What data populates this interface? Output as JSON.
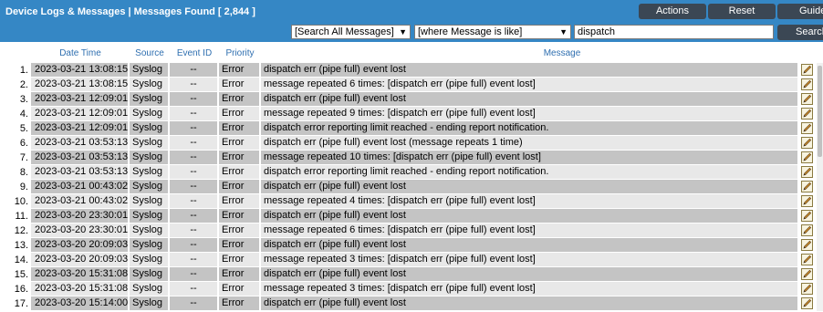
{
  "header": {
    "title": "Device Logs & Messages |  Messages Found [ 2,844 ]",
    "actions_label": "Actions",
    "reset_label": "Reset",
    "guide_label": "Guide"
  },
  "filter": {
    "scope_value": "[Search All Messages]",
    "condition_value": "[where Message is like]",
    "search_value": "dispatch",
    "search_label": "Search"
  },
  "columns": [
    "Date Time",
    "Source",
    "Event ID",
    "Priority",
    "Message"
  ],
  "rows": [
    {
      "num": "1.",
      "datetime": "2023-03-21 13:08:15",
      "source": "Syslog",
      "event_id": "--",
      "priority": "Error",
      "message": "dispatch err (pipe full) event lost"
    },
    {
      "num": "2.",
      "datetime": "2023-03-21 13:08:15",
      "source": "Syslog",
      "event_id": "--",
      "priority": "Error",
      "message": "message repeated 6 times: [dispatch err (pipe full) event lost]"
    },
    {
      "num": "3.",
      "datetime": "2023-03-21 12:09:01",
      "source": "Syslog",
      "event_id": "--",
      "priority": "Error",
      "message": "dispatch err (pipe full) event lost"
    },
    {
      "num": "4.",
      "datetime": "2023-03-21 12:09:01",
      "source": "Syslog",
      "event_id": "--",
      "priority": "Error",
      "message": "message repeated 9 times: [dispatch err (pipe full) event lost]"
    },
    {
      "num": "5.",
      "datetime": "2023-03-21 12:09:01",
      "source": "Syslog",
      "event_id": "--",
      "priority": "Error",
      "message": "dispatch error reporting limit reached - ending report notification."
    },
    {
      "num": "6.",
      "datetime": "2023-03-21 03:53:13",
      "source": "Syslog",
      "event_id": "--",
      "priority": "Error",
      "message": "dispatch err (pipe full) event lost (message repeats 1 time)"
    },
    {
      "num": "7.",
      "datetime": "2023-03-21 03:53:13",
      "source": "Syslog",
      "event_id": "--",
      "priority": "Error",
      "message": "message repeated 10 times: [dispatch err (pipe full) event lost]"
    },
    {
      "num": "8.",
      "datetime": "2023-03-21 03:53:13",
      "source": "Syslog",
      "event_id": "--",
      "priority": "Error",
      "message": "dispatch error reporting limit reached - ending report notification."
    },
    {
      "num": "9.",
      "datetime": "2023-03-21 00:43:02",
      "source": "Syslog",
      "event_id": "--",
      "priority": "Error",
      "message": "dispatch err (pipe full) event lost"
    },
    {
      "num": "10.",
      "datetime": "2023-03-21 00:43:02",
      "source": "Syslog",
      "event_id": "--",
      "priority": "Error",
      "message": "message repeated 4 times: [dispatch err (pipe full) event lost]"
    },
    {
      "num": "11.",
      "datetime": "2023-03-20 23:30:01",
      "source": "Syslog",
      "event_id": "--",
      "priority": "Error",
      "message": "dispatch err (pipe full) event lost"
    },
    {
      "num": "12.",
      "datetime": "2023-03-20 23:30:01",
      "source": "Syslog",
      "event_id": "--",
      "priority": "Error",
      "message": "message repeated 6 times: [dispatch err (pipe full) event lost]"
    },
    {
      "num": "13.",
      "datetime": "2023-03-20 20:09:03",
      "source": "Syslog",
      "event_id": "--",
      "priority": "Error",
      "message": "dispatch err (pipe full) event lost"
    },
    {
      "num": "14.",
      "datetime": "2023-03-20 20:09:03",
      "source": "Syslog",
      "event_id": "--",
      "priority": "Error",
      "message": "message repeated 3 times: [dispatch err (pipe full) event lost]"
    },
    {
      "num": "15.",
      "datetime": "2023-03-20 15:31:08",
      "source": "Syslog",
      "event_id": "--",
      "priority": "Error",
      "message": "dispatch err (pipe full) event lost"
    },
    {
      "num": "16.",
      "datetime": "2023-03-20 15:31:08",
      "source": "Syslog",
      "event_id": "--",
      "priority": "Error",
      "message": "message repeated 3 times: [dispatch err (pipe full) event lost]"
    },
    {
      "num": "17.",
      "datetime": "2023-03-20 15:14:00",
      "source": "Syslog",
      "event_id": "--",
      "priority": "Error",
      "message": "dispatch err (pipe full) event lost"
    }
  ],
  "icons": {
    "edit": "pencil-icon",
    "search": "magnifier-icon",
    "dropdown": "chevron-down-icon"
  },
  "colors": {
    "header_bg": "#3587c5",
    "button_bg": "#3b4754",
    "row_dark": "#c4c4c4",
    "row_light": "#e8e8e8",
    "header_text": "#2f6fb0"
  }
}
